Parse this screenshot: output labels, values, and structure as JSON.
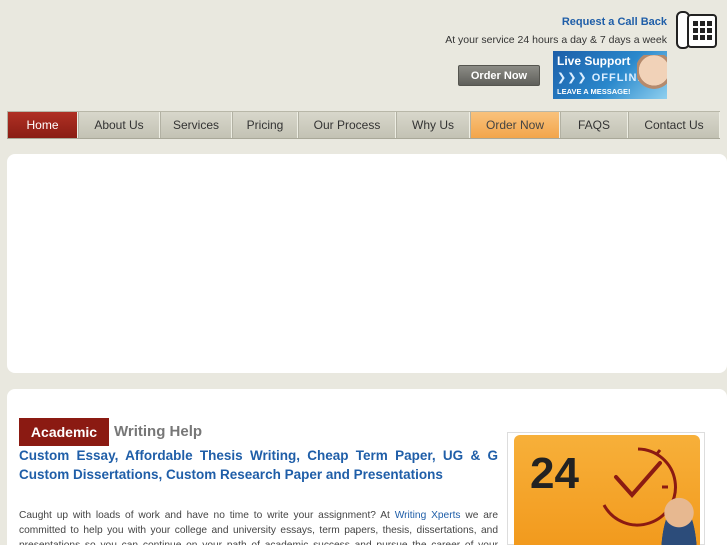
{
  "header": {
    "callback": "Request a Call Back",
    "service": "At your service 24 hours a day & 7 days a week",
    "order_button": "Order Now",
    "live_support": {
      "title": "Live Support",
      "status": "OFFLINE",
      "message": "LEAVE A MESSAGE!",
      "arrows": "❯❯❯"
    }
  },
  "nav": {
    "items": [
      {
        "label": "Home"
      },
      {
        "label": "About Us"
      },
      {
        "label": "Services"
      },
      {
        "label": "Pricing"
      },
      {
        "label": "Our Process"
      },
      {
        "label": "Why Us"
      },
      {
        "label": "Order Now"
      },
      {
        "label": "FAQS"
      },
      {
        "label": "Contact Us"
      }
    ]
  },
  "content": {
    "tag": "Academic",
    "tag_rest": "Writing Help",
    "headline": "Custom Essay, Affordable Thesis Writing, Cheap Term Paper, UG & G Custom Dissertations, Custom Research Paper and Presentations",
    "para_1": "Caught up with loads of work and have no time to write your assignment? At",
    "para_link": "Writing Xperts",
    "para_2": "we are committed to help you with your college and university essays, term papers, thesis, dissertations, and presentations so you can continue on your path of academic success and pursue the career of your choice.",
    "box_number": "24"
  },
  "colors": {
    "brand_blue": "#1f5ea8",
    "brand_red": "#8b1a12",
    "accent_orange": "#f2a54b"
  }
}
